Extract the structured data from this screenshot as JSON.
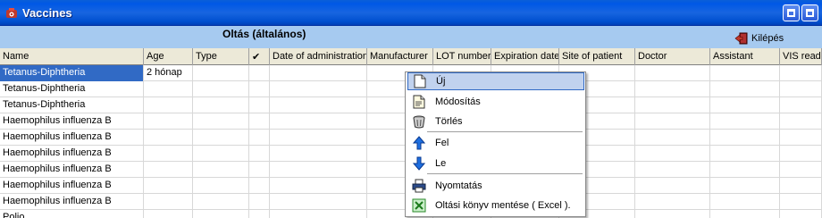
{
  "window": {
    "title": "Vaccines"
  },
  "header": {
    "section_title": "Oltás (általános)",
    "exit_label": "Kilépés"
  },
  "columns": [
    "Name",
    "Age",
    "Type",
    "✔",
    "Date of administration",
    "Manufacturer",
    "LOT number",
    "Expiration date",
    "Site of patient",
    "Doctor",
    "Assistant",
    "VIS read"
  ],
  "rows": [
    [
      "Tetanus-Diphtheria",
      "2 hónap",
      "",
      "",
      "",
      "",
      "",
      "",
      "",
      "",
      "",
      ""
    ],
    [
      "Tetanus-Diphtheria",
      "",
      "",
      "",
      "",
      "",
      "",
      "",
      "",
      "",
      "",
      ""
    ],
    [
      "Tetanus-Diphtheria",
      "",
      "",
      "",
      "",
      "",
      "",
      "",
      "",
      "",
      "",
      ""
    ],
    [
      "Haemophilus influenza B",
      "",
      "",
      "",
      "",
      "",
      "",
      "",
      "",
      "",
      "",
      ""
    ],
    [
      "Haemophilus influenza B",
      "",
      "",
      "",
      "",
      "",
      "",
      "",
      "",
      "",
      "",
      ""
    ],
    [
      "Haemophilus influenza B",
      "",
      "",
      "",
      "",
      "",
      "",
      "",
      "",
      "",
      "",
      ""
    ],
    [
      "Haemophilus influenza B",
      "",
      "",
      "",
      "",
      "",
      "",
      "",
      "",
      "",
      "",
      ""
    ],
    [
      "Haemophilus influenza B",
      "",
      "",
      "",
      "",
      "",
      "",
      "",
      "",
      "",
      "",
      ""
    ],
    [
      "Haemophilus influenza B",
      "",
      "",
      "",
      "",
      "",
      "",
      "",
      "",
      "",
      "",
      ""
    ],
    [
      "Polio",
      "",
      "",
      "",
      "",
      "",
      "",
      "",
      "",
      "",
      "",
      ""
    ]
  ],
  "context_menu": {
    "items": [
      {
        "label": "Új",
        "icon": "new-document-icon"
      },
      {
        "label": "Módosítás",
        "icon": "edit-document-icon"
      },
      {
        "label": "Törlés",
        "icon": "trash-icon"
      },
      {
        "label": "Fel",
        "icon": "arrow-up-icon"
      },
      {
        "label": "Le",
        "icon": "arrow-down-icon"
      },
      {
        "label": "Nyomtatás",
        "icon": "printer-icon"
      },
      {
        "label": "Oltási könyv mentése ( Excel ).",
        "icon": "excel-icon"
      }
    ]
  },
  "colors": {
    "title_bar": "#0058e6",
    "header_strip": "#a6caf0",
    "selection": "#316ac5",
    "menu_hover": "#c1d2ee"
  }
}
